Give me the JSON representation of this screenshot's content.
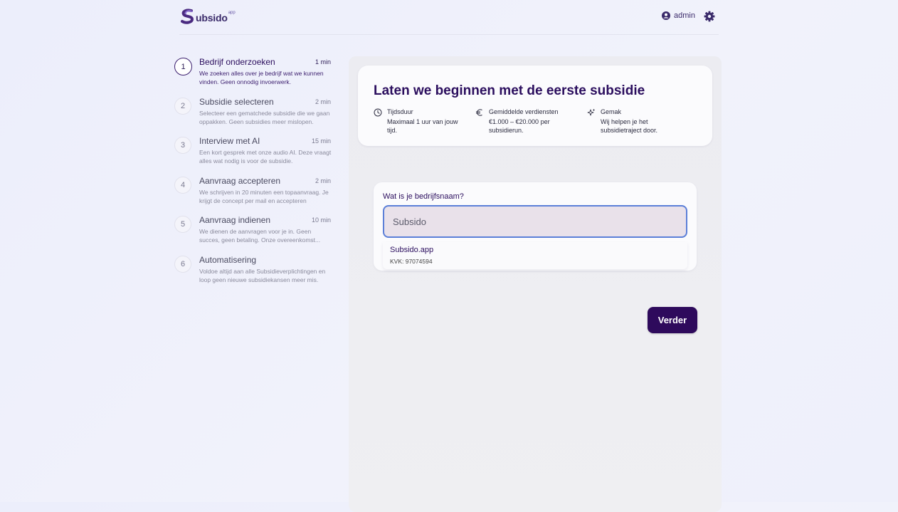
{
  "header": {
    "logo_text": "ubsido",
    "logo_sup": "app",
    "user_name": "admin",
    "user_icon": "user-circle-icon",
    "settings_icon": "gear-icon"
  },
  "steps": [
    {
      "number": "1",
      "title": "Bedrijf onderzoeken",
      "duration": "1 min",
      "description": "We zoeken alles over je bedrijf wat we kunnen vinden. Geen onnodig invoerwerk.",
      "active": true
    },
    {
      "number": "2",
      "title": "Subsidie selecteren",
      "duration": "2 min",
      "description": "Selecteer een gematchede subsidie die we gaan oppakken. Geen subsidies meer mislopen.",
      "active": false
    },
    {
      "number": "3",
      "title": "Interview met AI",
      "duration": "15 min",
      "description": "Een kort gesprek met onze audio AI. Deze vraagt alles wat nodig is voor de subsidie.",
      "active": false
    },
    {
      "number": "4",
      "title": "Aanvraag accepteren",
      "duration": "2 min",
      "description": "We schrijven in 20 minuten een topaanvraag. Je krijgt de concept per mail en accepteren",
      "active": false
    },
    {
      "number": "5",
      "title": "Aanvraag indienen",
      "duration": "10 min",
      "description": "We dienen de aanvragen voor je in. Geen succes, geen betaling. Onze overeenkomst...",
      "active": false
    },
    {
      "number": "6",
      "title": "Automatisering",
      "duration": "",
      "description": "Voldoe altijd aan alle Subsidieverplichtingen en loop geen nieuwe subsidiekansen meer mis.",
      "active": false
    }
  ],
  "hero": {
    "title": "Laten we beginnen met de eerste subsidie",
    "features": [
      {
        "icon": "clock-icon",
        "label": "Tijdsduur",
        "text": "Maximaal 1 uur van jouw tijd."
      },
      {
        "icon": "euro-icon",
        "label": "Gemiddelde verdiensten",
        "text": "€1.000 – €20.000 per subsidierun."
      },
      {
        "icon": "sparkles-icon",
        "label": "Gemak",
        "text": "Wij helpen je het subsidietraject door."
      }
    ]
  },
  "form": {
    "label": "Wat is je bedrijfsnaam?",
    "value": "Subsido",
    "suggestion": {
      "name": "Subsido.app",
      "kvk": "KVK: 97074594"
    }
  },
  "next_button": "Verder",
  "colors": {
    "brand": "#2e0a5c",
    "input_border": "#5b7fd8"
  }
}
